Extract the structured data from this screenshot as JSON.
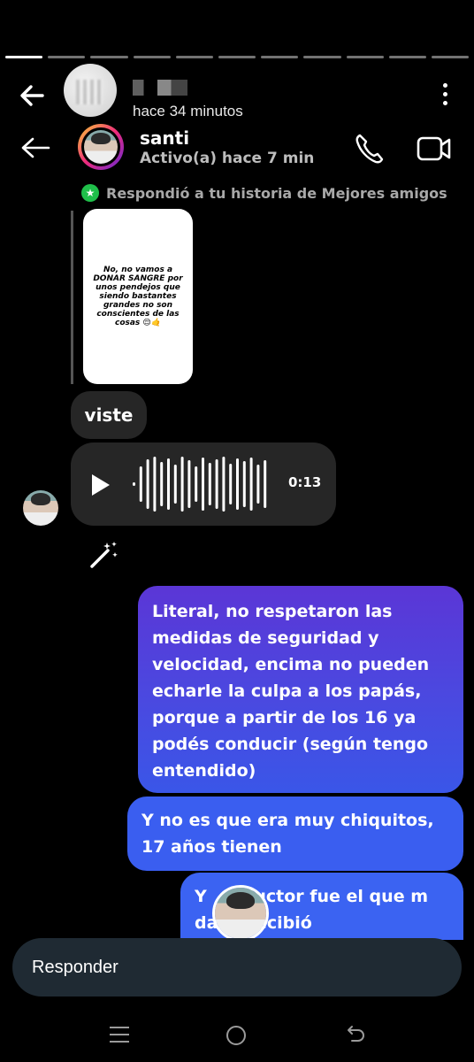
{
  "story": {
    "progress_segments": 11,
    "active_segment": 0,
    "posted": "hace 34 minutos"
  },
  "chat": {
    "contact_name": "santi",
    "status": "Activo(a) hace 7 min"
  },
  "reply_context": {
    "note": "Respondió a tu historia de Mejores amigos",
    "story_text": "No, no vamos a DONAR SANGRE por unos pendejos que siendo bastantes grandes no son conscientes de las cosas 😌🤙"
  },
  "messages": {
    "received_text": "viste",
    "voice_duration": "0:13",
    "sent": [
      "Literal, no respetaron las medidas de seguridad y velocidad, encima no pueden echarle la culpa a los papás, porque a partir de los 16 ya podés conducir (según tengo entendido)",
      "Y no es que era muy chiquitos, 17 años tienen",
      "Y    nductor fue el que m     daño recibió"
    ]
  },
  "composer": {
    "placeholder": "Responder"
  },
  "colors": {
    "background": "#000000",
    "received_bubble": "#262626",
    "sent_gradient_top": "#5b36d6",
    "sent_bottom": "#3b63f2",
    "composer": "#1f2a33",
    "close_friends": "#1fbf4a"
  },
  "icons": [
    "back-arrow-icon",
    "more-options-icon",
    "phone-icon",
    "video-camera-icon",
    "green-star-icon",
    "play-icon",
    "magic-wand-icon",
    "nav-recents-icon",
    "nav-home-icon",
    "nav-back-icon"
  ]
}
